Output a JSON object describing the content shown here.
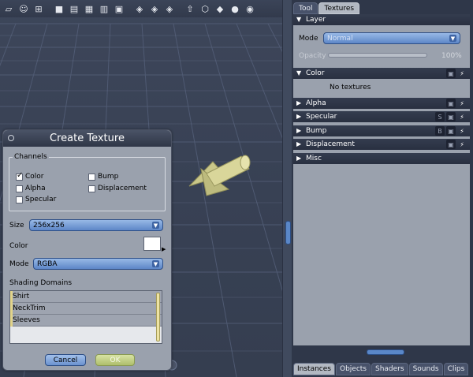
{
  "dialog": {
    "title": "Create Texture",
    "channels_legend": "Channels",
    "channels": [
      {
        "label": "Color",
        "checked": true
      },
      {
        "label": "Bump",
        "checked": false
      },
      {
        "label": "Alpha",
        "checked": false
      },
      {
        "label": "Displacement",
        "checked": false
      },
      {
        "label": "Specular",
        "checked": false
      }
    ],
    "size_label": "Size",
    "size_value": "256x256",
    "color_label": "Color",
    "mode_label": "Mode",
    "mode_value": "RGBA",
    "shading_domains_label": "Shading Domains",
    "shading_domains": [
      "Shirt",
      "NeckTrim",
      "Sleeves"
    ],
    "cancel_label": "Cancel",
    "ok_label": "OK"
  },
  "right_panel": {
    "tabs": [
      "Tool",
      "Textures"
    ],
    "active_tab": "Textures",
    "layer_header": "Layer",
    "mode_label": "Mode",
    "mode_value": "Normal",
    "opacity_label": "Opacity",
    "opacity_value": "100%",
    "color_header": "Color",
    "no_textures": "No textures",
    "sections": [
      {
        "label": "Alpha",
        "badge": ""
      },
      {
        "label": "Specular",
        "badge": "S"
      },
      {
        "label": "Bump",
        "badge": "B"
      },
      {
        "label": "Displacement",
        "badge": ""
      },
      {
        "label": "Misc",
        "badge": ""
      }
    ],
    "bottom_tabs": [
      "Instances",
      "Objects",
      "Shaders",
      "Sounds",
      "Clips"
    ],
    "active_bottom_tab": "Instances"
  },
  "colors": {
    "select_blue": "#6f97d2",
    "ok_green": "#c2d084",
    "object_yellow": "#d9d69a"
  },
  "icons": [
    "unknown-icon",
    "people-icon",
    "grid-target-icon",
    "layout-single-icon",
    "layout-split-icon",
    "layout-quad-icon",
    "layout-tri-icon",
    "palette-icon",
    "shader-icon-1",
    "shader-icon-2",
    "shader-icon-3",
    "arrow-up-icon",
    "vertex-icon",
    "cube-icon",
    "sphere-icon",
    "sphere-shaded-icon"
  ]
}
